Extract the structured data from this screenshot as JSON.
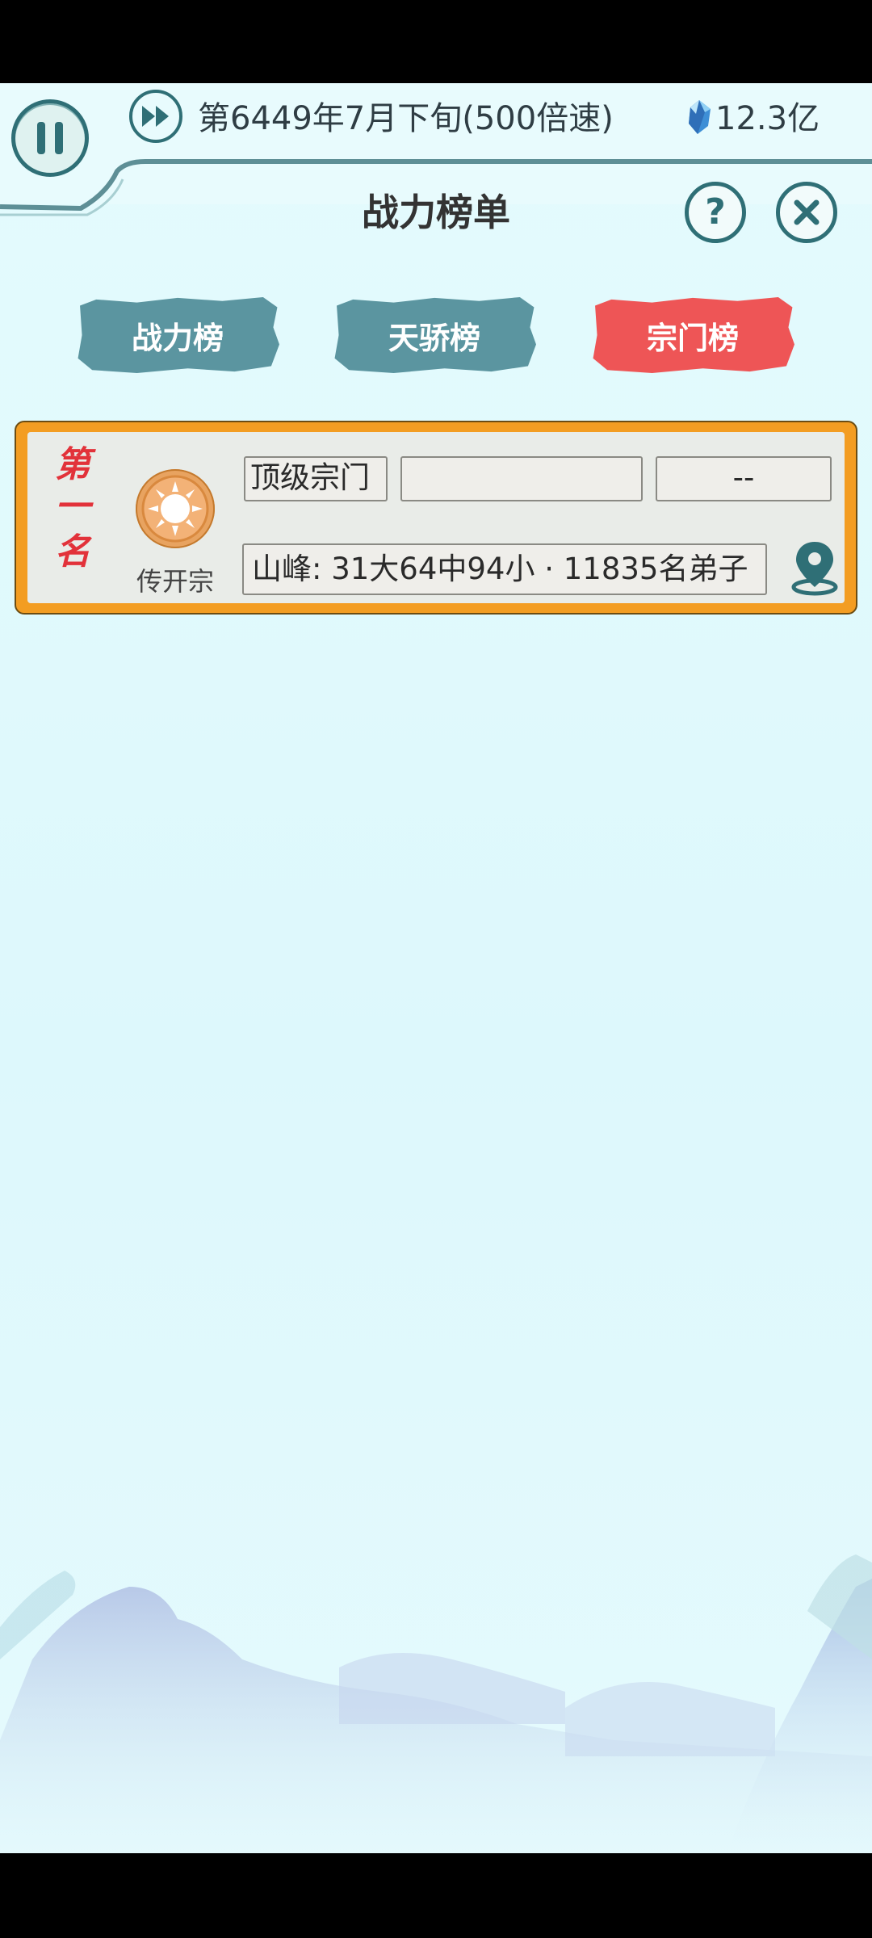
{
  "topbar": {
    "date_text": "第6449年7月下旬(500倍速)",
    "currency_value": "12.3亿"
  },
  "page": {
    "title": "战力榜单"
  },
  "tabs": [
    {
      "label": "战力榜",
      "selected": false
    },
    {
      "label": "天骄榜",
      "selected": false
    },
    {
      "label": "宗门榜",
      "selected": true
    }
  ],
  "ranking": [
    {
      "rank_chars": [
        "第",
        "一",
        "名"
      ],
      "sect_name": "传开宗",
      "tier": "顶级宗门",
      "blank_field": "",
      "score": "--",
      "details": "山峰: 31大64中94小 · 11835名弟子"
    }
  ],
  "colors": {
    "accent_teal": "#5b95a0",
    "selected_red": "#ee5556",
    "card_border": "#f39d22",
    "rank_red": "#e2323a"
  }
}
